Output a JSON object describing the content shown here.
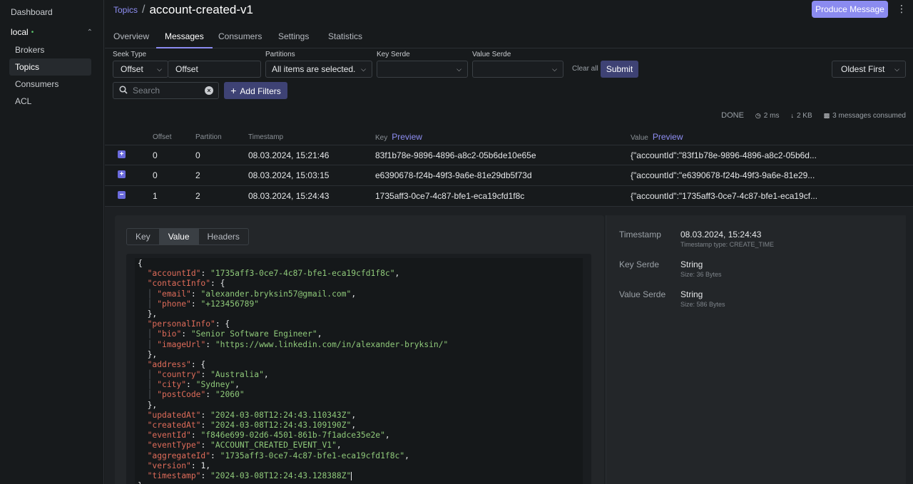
{
  "sidebar": {
    "dashboard": "Dashboard",
    "cluster": {
      "name": "local",
      "status_dot": "•"
    },
    "items": [
      {
        "label": "Brokers"
      },
      {
        "label": "Topics"
      },
      {
        "label": "Consumers"
      },
      {
        "label": "ACL"
      }
    ]
  },
  "header": {
    "breadcrumb_link": "Topics",
    "separator": "/",
    "title": "account-created-v1",
    "produce_button": "Produce Message"
  },
  "tabs": [
    {
      "label": "Overview"
    },
    {
      "label": "Messages"
    },
    {
      "label": "Consumers"
    },
    {
      "label": "Settings"
    },
    {
      "label": "Statistics"
    }
  ],
  "filters": {
    "seek_type_label": "Seek Type",
    "seek_type_value": "Offset",
    "seek_input_value": "Offset",
    "partitions_label": "Partitions",
    "partitions_value": "All items are selected.",
    "key_serde_label": "Key Serde",
    "key_serde_value": "",
    "value_serde_label": "Value Serde",
    "value_serde_value": "",
    "clear_all": "Clear all",
    "submit": "Submit",
    "sort_value": "Oldest First",
    "search_placeholder": "Search",
    "add_filters": "Add Filters"
  },
  "stats": {
    "status": "DONE",
    "time": "2 ms",
    "size": "2 KB",
    "consumed": "3 messages consumed"
  },
  "table": {
    "headers": {
      "offset": "Offset",
      "partition": "Partition",
      "timestamp": "Timestamp",
      "key": "Key",
      "value": "Value",
      "preview": "Preview"
    },
    "rows": [
      {
        "expander": "+",
        "offset": "0",
        "partition": "0",
        "timestamp": "08.03.2024, 15:21:46",
        "key": "83f1b78e-9896-4896-a8c2-05b6de10e65e",
        "value": "{\"accountId\":\"83f1b78e-9896-4896-a8c2-05b6d..."
      },
      {
        "expander": "+",
        "offset": "0",
        "partition": "2",
        "timestamp": "08.03.2024, 15:03:15",
        "key": "e6390678-f24b-49f3-9a6e-81e29db5f73d",
        "value": "{\"accountId\":\"e6390678-f24b-49f3-9a6e-81e29..."
      },
      {
        "expander": "−",
        "offset": "1",
        "partition": "2",
        "timestamp": "08.03.2024, 15:24:43",
        "key": "1735aff3-0ce7-4c87-bfe1-eca19cfd1f8c",
        "value": "{\"accountId\":\"1735aff3-0ce7-4c87-bfe1-eca19cf..."
      }
    ]
  },
  "detail": {
    "tabs": [
      {
        "label": "Key"
      },
      {
        "label": "Value"
      },
      {
        "label": "Headers"
      }
    ],
    "json": {
      "accountId": "1735aff3-0ce7-4c87-bfe1-eca19cfd1f8c",
      "email": "alexander.bryksin57@gmail.com",
      "phone": "+123456789",
      "bio": "Senior Software Engineer",
      "imageUrl": "https://www.linkedin.com/in/alexander-bryksin/",
      "country": "Australia",
      "city": "Sydney",
      "postCode": "2060",
      "updatedAt": "2024-03-08T12:24:43.110343Z",
      "createdAt": "2024-03-08T12:24:43.109190Z",
      "eventId": "f846e699-02d6-4501-861b-7f1adce35e2e",
      "eventType": "ACCOUNT_CREATED_EVENT_V1",
      "aggregateId": "1735aff3-0ce7-4c87-bfe1-eca19cfd1f8c",
      "version": "1",
      "timestamp": "2024-03-08T12:24:43.128388Z"
    },
    "meta": {
      "timestamp_label": "Timestamp",
      "timestamp_value": "08.03.2024, 15:24:43",
      "timestamp_sub": "Timestamp type: CREATE_TIME",
      "key_serde_label": "Key Serde",
      "key_serde_value": "String",
      "key_serde_sub": "Size: 36 Bytes",
      "value_serde_label": "Value Serde",
      "value_serde_value": "String",
      "value_serde_sub": "Size: 586 Bytes"
    }
  }
}
